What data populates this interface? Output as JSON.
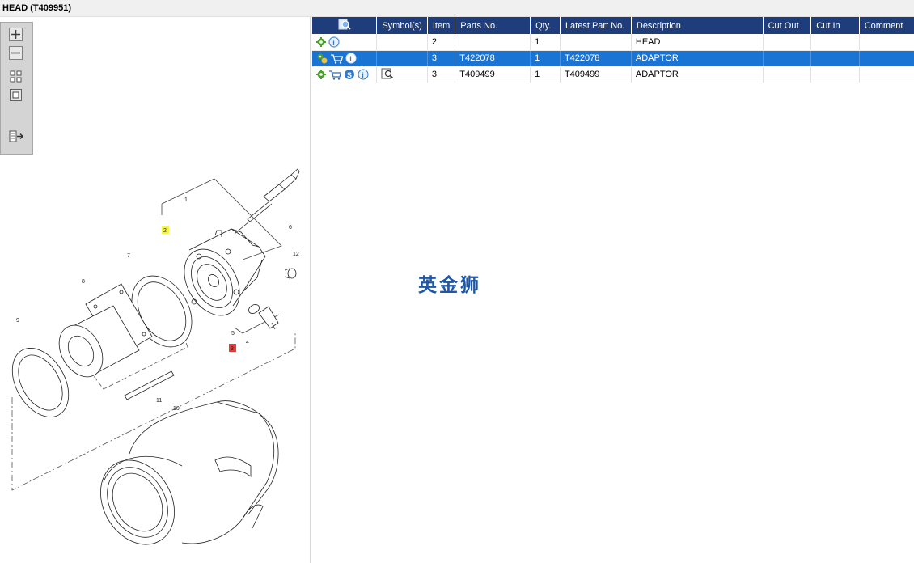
{
  "window": {
    "title": "HEAD (T409951)"
  },
  "toolbar": {
    "buttons": [
      {
        "name": "zoom-in",
        "icon": "plus-icon"
      },
      {
        "name": "zoom-out",
        "icon": "minus-icon"
      },
      {
        "name": "fit-all",
        "icon": "grid-icon"
      },
      {
        "name": "fit-window",
        "icon": "square-icon"
      },
      {
        "name": "export",
        "icon": "export-icon"
      }
    ]
  },
  "diagram": {
    "callouts": [
      "1",
      "2",
      "3",
      "4",
      "5",
      "6",
      "7",
      "8",
      "9",
      "10",
      "11",
      "12"
    ]
  },
  "table": {
    "headers": {
      "search": "",
      "symbols": "Symbol(s)",
      "item": "Item",
      "parts_no": "Parts No.",
      "qty": "Qty.",
      "latest_part_no": "Latest Part No.",
      "description": "Description",
      "cut_out": "Cut Out",
      "cut_in": "Cut In",
      "comment": "Comment"
    },
    "rows": [
      {
        "item": "2",
        "parts_no": "",
        "qty": "1",
        "latest_part_no": "",
        "description": "HEAD",
        "cut_out": "",
        "cut_in": "",
        "comment": "",
        "selected": false,
        "icons": [
          "gear-icon",
          "info-icon"
        ],
        "symbol": ""
      },
      {
        "item": "3",
        "parts_no": "T422078",
        "qty": "1",
        "latest_part_no": "T422078",
        "description": "ADAPTOR",
        "cut_out": "",
        "cut_in": "",
        "comment": "",
        "selected": true,
        "icons": [
          "gear-selected-icon",
          "cart-icon",
          "info-icon"
        ],
        "symbol": ""
      },
      {
        "item": "3",
        "parts_no": "T409499",
        "qty": "1",
        "latest_part_no": "T409499",
        "description": "ADAPTOR",
        "cut_out": "",
        "cut_in": "",
        "comment": "",
        "selected": false,
        "icons": [
          "gear-icon",
          "cart-icon",
          "s-icon",
          "info-icon"
        ],
        "symbol": "magnify-doc-icon"
      }
    ]
  },
  "watermark": "英金狮",
  "colors": {
    "header": "#1f3d7a",
    "selected": "#1a74d4",
    "gear": "#4a9e2a",
    "info": "#2f7bc8"
  }
}
